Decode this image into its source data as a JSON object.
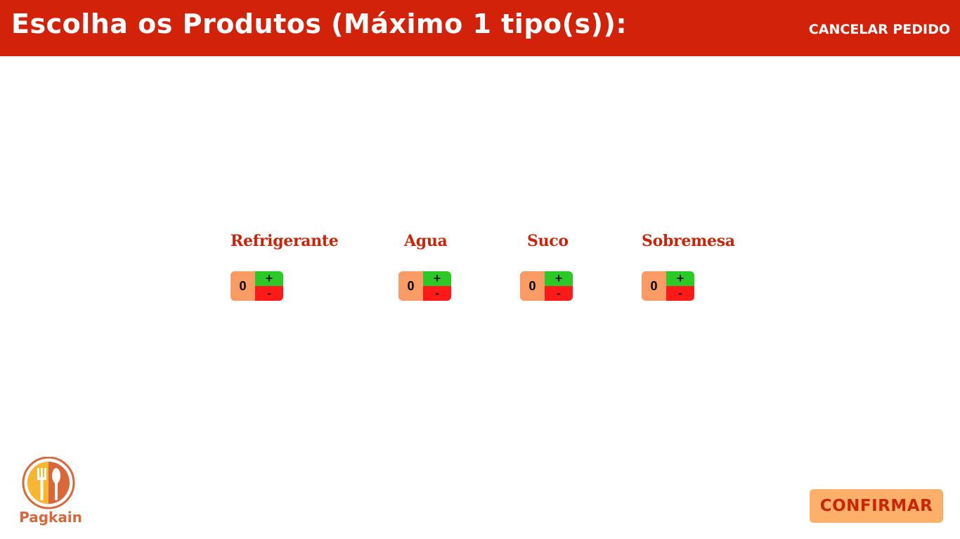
{
  "header": {
    "title": "Escolha os Produtos (Máximo 1 tipo(s)):",
    "cancel_label": "CANCELAR PEDIDO"
  },
  "products": [
    {
      "name": "Refrigerante",
      "quantity": "0",
      "plus": "+",
      "minus": "-"
    },
    {
      "name": "Agua",
      "quantity": "0",
      "plus": "+",
      "minus": "-"
    },
    {
      "name": "Suco",
      "quantity": "0",
      "plus": "+",
      "minus": "-"
    },
    {
      "name": "Sobremesa",
      "quantity": "0",
      "plus": "+",
      "minus": "-"
    }
  ],
  "logo": {
    "text": "Pagkain"
  },
  "footer": {
    "confirm_label": "CONFIRMAR"
  },
  "colors": {
    "header_bg": "#d2230a",
    "product_name": "#c9250b",
    "qty_bg": "#fa9a64",
    "plus_bg": "#2bc828",
    "minus_bg": "#ff1a1a",
    "confirm_bg": "#fdb06a"
  }
}
